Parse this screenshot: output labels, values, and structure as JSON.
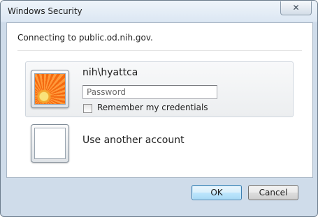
{
  "window": {
    "title": "Windows Security",
    "close_glyph": "✕"
  },
  "dialog": {
    "connecting_text": "Connecting to public.od.nih.gov.",
    "user_tile": {
      "username": "nih\\hyattca",
      "password_placeholder": "Password",
      "password_value": "",
      "remember_label": "Remember my credentials",
      "remember_checked": false,
      "picture_icon": "orange-flower-icon"
    },
    "other_account": {
      "label": "Use another account",
      "picture_icon": "blank-user-icon"
    }
  },
  "buttons": {
    "ok_label": "OK",
    "cancel_label": "Cancel"
  },
  "colors": {
    "selected_panel": "#eceef0",
    "ok_button_accent": "#3c7fb1"
  }
}
